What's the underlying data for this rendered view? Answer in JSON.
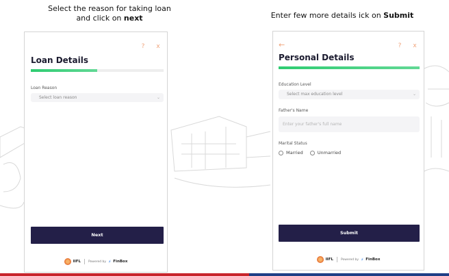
{
  "instructions": {
    "left_line1": "Select the reason for taking loan",
    "left_line2_prefix": "and click on ",
    "left_line2_bold": "next",
    "right_prefix": "Enter few more details ick on ",
    "right_bold": "Submit"
  },
  "loan_card": {
    "help_icon": "?",
    "close_icon": "x",
    "title": "Loan Details",
    "progress": 0.5,
    "loan_reason_label": "Loan Reason",
    "loan_reason_placeholder": "Select loan reason",
    "next_button": "Next",
    "footer": {
      "brand": "IIFL",
      "brand_sub": "FINANCE",
      "powered_by": "Powered by",
      "partner": "FinBox"
    }
  },
  "personal_card": {
    "back_icon": "←",
    "help_icon": "?",
    "close_icon": "x",
    "title": "Personal Details",
    "progress": 1.0,
    "education_label": "Education Level",
    "education_placeholder": "Select max education level",
    "father_label": "Father's Name",
    "father_placeholder": "Enter your father's full name",
    "marital_label": "Marital Status",
    "marital_options": [
      "Married",
      "Unmarried"
    ],
    "submit_button": "Submit",
    "footer": {
      "brand": "IIFL",
      "brand_sub": "FINANCE",
      "powered_by": "Powered by",
      "partner": "FinBox"
    }
  },
  "colors": {
    "accent_orange": "#f0a37a",
    "progress_green": "#2ecc71",
    "button_navy": "#231f48",
    "bar_red": "#c8252c",
    "bar_blue": "#1f3f86"
  }
}
